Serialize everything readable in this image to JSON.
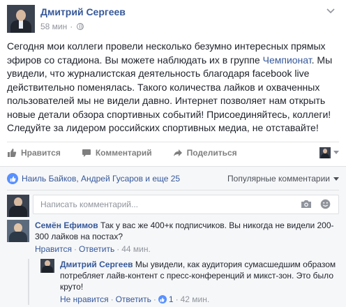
{
  "post": {
    "author": "Дмитрий Сергеев",
    "time": "58 мин",
    "separator": "·",
    "text_before_group": "Сегодня мои коллеги провели несколько безумно интересных прямых эфиров со стадиона. Вы можете наблюдать их в группе ",
    "group_link": "Чемпионат",
    "text_after_group": ". Мы увидели, что журналистская деятельность благодаря facebook live действительно поменялась. Такого количества лайков и охваченных пользователей мы не видели давно. Интернет позволяет нам открыть новые детали обзора спортивных событий! Присоединяйтесь, коллеги! Следуйте за лидером российских спортивных медиа, не отставайте!",
    "icons": {
      "privacy": "globe-icon",
      "options": "chevron-down-icon"
    }
  },
  "actions": {
    "like": "Нравится",
    "comment": "Комментарий",
    "share": "Поделиться",
    "icons": [
      "thumbs-up-icon",
      "comment-icon",
      "share-icon"
    ]
  },
  "reactions": {
    "likers": "Наиль Байков, Андрей Гусаров и еще 25",
    "sort_label": "Популярные комментарии"
  },
  "compose": {
    "placeholder": "Написать комментарий...",
    "icons": [
      "camera-icon",
      "smiley-icon"
    ]
  },
  "comments": [
    {
      "author": "Семён Ефимов",
      "text": "Так у вас же 400+к подписчиков. Вы никогда не видели 200-300 лайков на постах?",
      "like_label": "Нравится",
      "reply_label": "Ответить",
      "time": "44 мин."
    },
    {
      "author": "Дмитрий Сергеев",
      "text": "Мы увидели, как аудитория сумасшедшим образом потребляет лайв-контент с пресс-конференций и микст-зон. Это было круто!",
      "like_label": "Не нравится",
      "reply_label": "Ответить",
      "like_count": "1",
      "time": "42 мин."
    }
  ],
  "colors": {
    "link": "#365899",
    "muted": "#90949c",
    "like_blue": "#5890ff",
    "comments_bg": "#f6f7f9"
  }
}
